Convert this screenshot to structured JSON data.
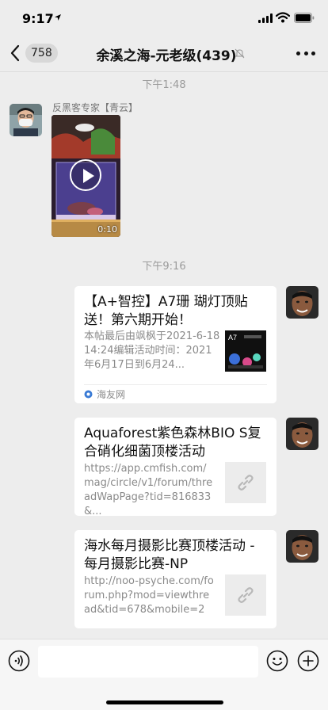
{
  "status_bar": {
    "time": "9:17"
  },
  "nav": {
    "unread_count": "758",
    "title": "余溪之海-元老级(439)"
  },
  "messages": {
    "timestamp_1": "下午1:48",
    "sender_name": "反黑客专家【青云】",
    "video_duration": "0:10",
    "timestamp_2": "下午9:16"
  },
  "cards": [
    {
      "title": "【A+智控】A7珊 瑚灯顶贴送！第六期开始！",
      "description": "本帖最后由飒枫于2021-6-1814:24编辑活动时间：2021年6月17日到6月24...",
      "thumb_text": "A7",
      "source": "海友网"
    },
    {
      "title": "Aquaforest紫色森林BIO S复合硝化细菌顶楼活动",
      "description": "https://app.cmfish.com/mag/circle/v1/forum/threadWapPage?tid=816833&..."
    },
    {
      "title": "海水每月摄影比赛顶楼活动 - 每月摄影比赛-NP",
      "description": "http://noo-psyche.com/forum.php?mod=viewthread&tid=678&mobile=2"
    }
  ],
  "colors": {
    "background": "#ededed",
    "bubble": "#ffffff",
    "timestamp": "#9a9a9a"
  }
}
